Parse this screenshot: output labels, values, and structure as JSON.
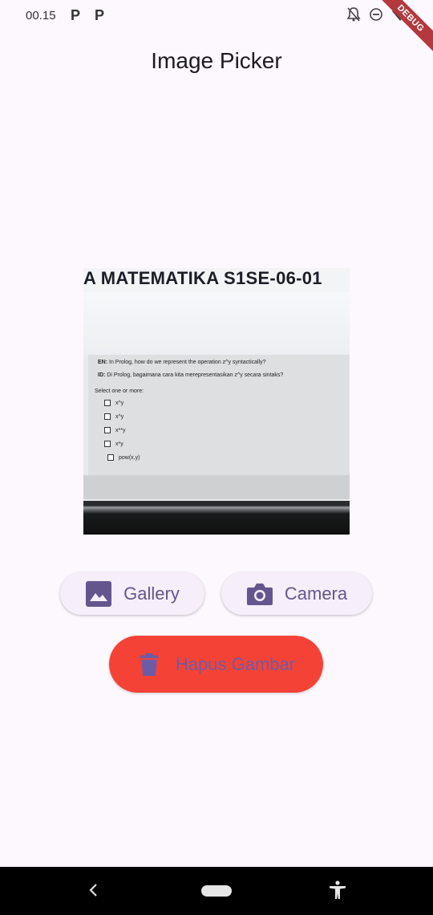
{
  "status_bar": {
    "time": "00.15",
    "app_icons": [
      "P",
      "P"
    ]
  },
  "debug_banner": "DEBUG",
  "app_bar": {
    "title": "Image Picker"
  },
  "preview": {
    "header_text": "A MATEMATIKA S1SE-06-01",
    "question_en": "In Prolog, how do we represent the operation z^y syntactically?",
    "question_en_prefix": "EN:",
    "question_id": "Di Prolog, bagaimana cara kita merepresentasikan z^y secara sintaks?",
    "question_id_prefix": "ID:",
    "instruction": "Select one or more:",
    "options": [
      "x^y",
      "x^y",
      "x**y",
      "x*y",
      "pow(x,y)"
    ]
  },
  "buttons": {
    "gallery": "Gallery",
    "camera": "Camera",
    "delete": "Hapus Gambar"
  },
  "colors": {
    "background": "#fdf7fe",
    "accent": "#65558f",
    "delete_button": "#f44336",
    "debug_banner": "#b4383d"
  },
  "icons": {
    "gallery": "image-icon",
    "camera": "camera-icon",
    "delete": "trash-icon"
  }
}
